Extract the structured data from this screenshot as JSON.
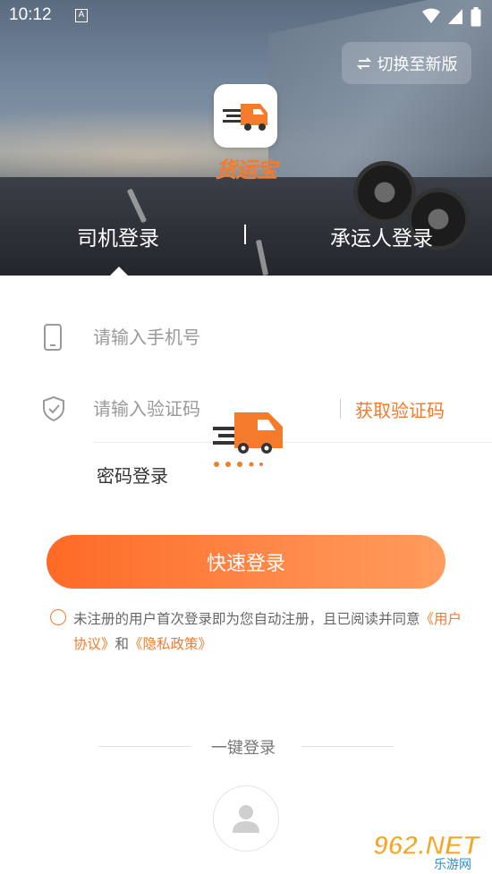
{
  "status_bar": {
    "time": "10:12",
    "a_badge": "A"
  },
  "header": {
    "switch_label": "切换至新版",
    "brand_name": "货运宝",
    "tabs": [
      {
        "label": "司机登录",
        "active": true
      },
      {
        "label": "承运人登录",
        "active": false
      }
    ]
  },
  "form": {
    "phone_placeholder": "请输入手机号",
    "code_placeholder": "请输入验证码",
    "get_code_label": "获取验证码",
    "password_login_label": "密码登录",
    "submit_label": "快速登录"
  },
  "agreement": {
    "prefix": "未注册的用户首次登录即为您自动注册，且已阅读并同意",
    "user_agreement": "《用户协议》",
    "and": "和",
    "privacy_policy": "《隐私政策》"
  },
  "one_key": {
    "label": "一键登录"
  },
  "watermark": {
    "text": "962.NET",
    "sub": "乐游网"
  },
  "colors": {
    "accent": "#f47a2c",
    "button_start": "#fe6a26",
    "button_end": "#ff9c5e"
  }
}
